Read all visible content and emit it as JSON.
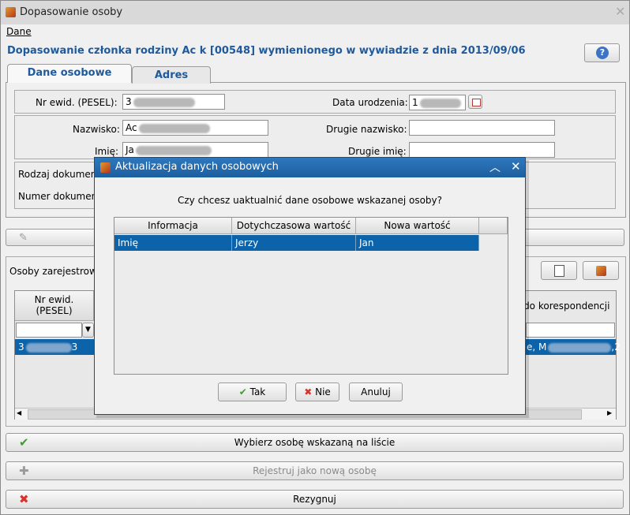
{
  "window": {
    "title": "Dopasowanie osoby",
    "menu": [
      "Dane"
    ]
  },
  "header": {
    "title": "Dopasowanie członka rodziny Ac      k [00548] wymienionego w wywiadzie z dnia 2013/09/06"
  },
  "tabs": [
    {
      "label": "Dane osobowe",
      "active": true
    },
    {
      "label": "Adres",
      "active": false
    }
  ],
  "form": {
    "pesel_label": "Nr ewid. (PESEL):",
    "pesel_value": "3",
    "birth_label": "Data urodzenia:",
    "birth_value": "1",
    "surname_label": "Nazwisko:",
    "surname_value": "Ac",
    "second_surname_label": "Drugie nazwisko:",
    "second_surname_value": "",
    "name_label": "Imię:",
    "name_value": "Ja",
    "second_name_label": "Drugie imię:",
    "second_name_value": "",
    "doc_type_label": "Rodzaj dokument",
    "doc_number_label": "Numer dokument"
  },
  "lower": {
    "section_label": "Osoby zarejestrow",
    "col_pesel": "Nr ewid.\n(PESEL)",
    "col_corr": "s do korespondencji",
    "row_pesel": "3",
    "row_pesel_suffix": "3",
    "row_corr": "e, M",
    "row_corr_suffix": ",2"
  },
  "buttons": {
    "select": "Wybierz osobę wskazaną na liście",
    "register": "Rejestruj jako nową osobę",
    "cancel": "Rezygnuj"
  },
  "dialog": {
    "title": "Aktualizacja danych osobowych",
    "question": "Czy chcesz uaktualnić dane osobowe wskazanej osoby?",
    "columns": [
      "Informacja",
      "Dotychczasowa wartość",
      "Nowa wartość"
    ],
    "rows": [
      {
        "info": "Imię",
        "old": "Jerzy",
        "new": "Jan"
      }
    ],
    "yes": "Tak",
    "no": "Nie",
    "cancel": "Anuluj"
  },
  "colors": {
    "accent": "#1f5a9c",
    "selection": "#0d63a9",
    "dialog_title": "#2e78bd"
  }
}
